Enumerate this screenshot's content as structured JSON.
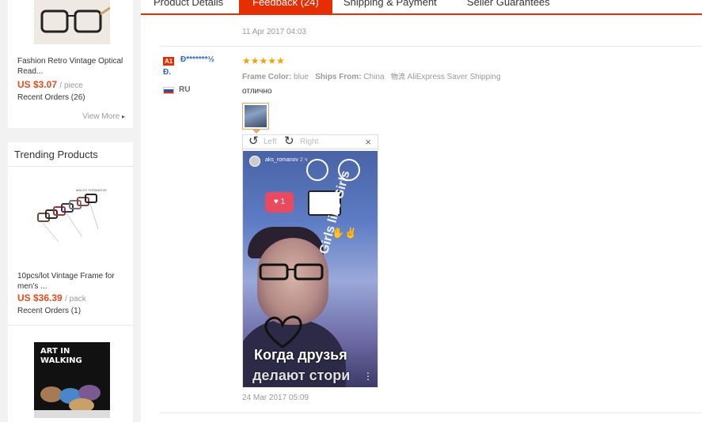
{
  "sidebar": {
    "product1": {
      "name": "Fashion Retro Vintage Optical Read...",
      "price": "US $3.07",
      "unit": "/ piece",
      "orders": "Recent Orders (26)",
      "view_more": "View More"
    },
    "trending_title": "Trending Products",
    "product2": {
      "name": "10pcs/lot Vintage Frame for men's ...",
      "price": "US $36.39",
      "unit": "/ pack",
      "orders": "Recent Orders (1)"
    },
    "product3": {
      "image_text": "ART IN WALKING"
    }
  },
  "tabs": [
    {
      "label": "Product Details"
    },
    {
      "label": "Feedback (24)"
    },
    {
      "label": "Shipping & Payment"
    },
    {
      "label": "Seller Guarantees"
    }
  ],
  "feedback": {
    "prev_date": "11 Apr 2017 04:03",
    "level_badge": "A1",
    "user_name": "Đ*******½",
    "user_name_line2": "Đ.",
    "country": "RU",
    "stars": "★★★★★",
    "frame_color_label": "Frame Color:",
    "frame_color_value": "blue",
    "ships_from_label": "Ships From:",
    "ships_from_value": "China",
    "shipping_method": "AliExpress Saver Shipping",
    "shipping_icon": "物流",
    "comment": "отлично",
    "viewer": {
      "rotate_left": "Left",
      "rotate_right": "Right",
      "close": "×",
      "story_user": "aks_romanov",
      "story_time": "2 ч",
      "like_count": "1",
      "overlay_text": "Girls like Girls",
      "caption_line1": "Когда друзья",
      "caption_line2": "делают стори"
    },
    "date": "24 Mar 2017 05:09"
  },
  "colors": {
    "accent": "#e62e04",
    "price": "#e64c1c",
    "star": "#f6a10a",
    "link": "#2a66c4"
  }
}
